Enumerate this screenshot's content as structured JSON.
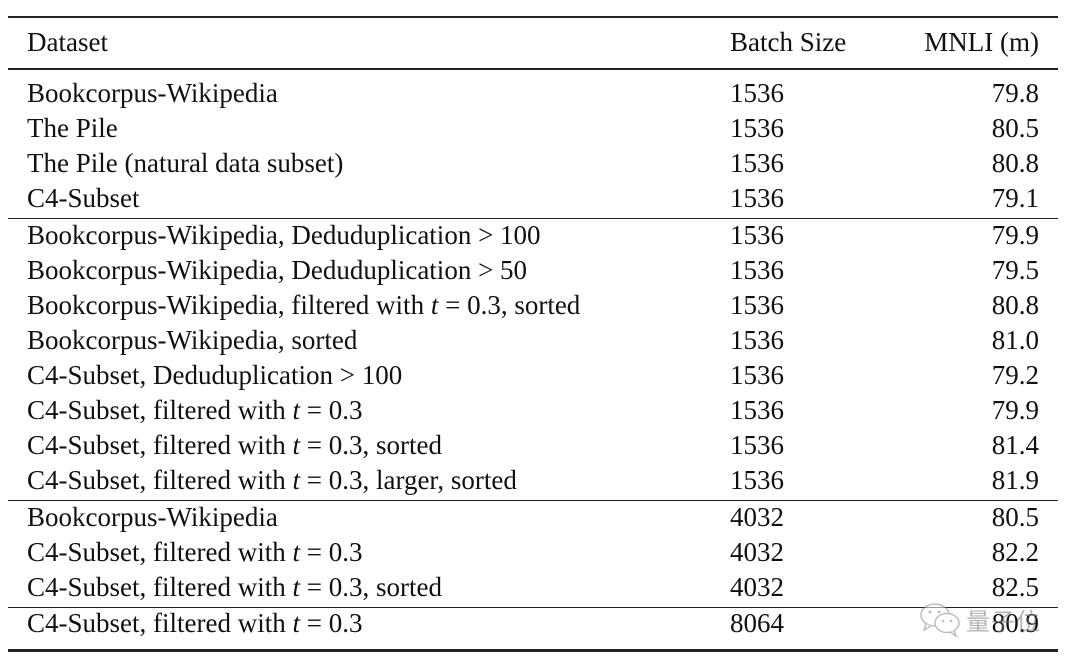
{
  "table": {
    "headers": {
      "dataset": "Dataset",
      "batch_size": "Batch Size",
      "mnli": "MNLI (m)"
    },
    "groups": [
      {
        "rows": [
          {
            "dataset": "Bookcorpus-Wikipedia",
            "batch_size": "1536",
            "mnli": "79.8"
          },
          {
            "dataset": "The Pile",
            "batch_size": "1536",
            "mnli": "80.5"
          },
          {
            "dataset": "The Pile (natural data subset)",
            "batch_size": "1536",
            "mnli": "80.8"
          },
          {
            "dataset": "C4-Subset",
            "batch_size": "1536",
            "mnli": "79.1"
          }
        ]
      },
      {
        "rows": [
          {
            "dataset": "Bookcorpus-Wikipedia, Deduduplication > 100",
            "batch_size": "1536",
            "mnli": "79.9"
          },
          {
            "dataset": "Bookcorpus-Wikipedia, Deduduplication > 50",
            "batch_size": "1536",
            "mnli": "79.5"
          },
          {
            "dataset": "Bookcorpus-Wikipedia, filtered with t = 0.3, sorted",
            "batch_size": "1536",
            "mnli": "80.8"
          },
          {
            "dataset": "Bookcorpus-Wikipedia, sorted",
            "batch_size": "1536",
            "mnli": "81.0"
          },
          {
            "dataset": "C4-Subset, Deduduplication > 100",
            "batch_size": "1536",
            "mnli": "79.2"
          },
          {
            "dataset": "C4-Subset, filtered with t = 0.3",
            "batch_size": "1536",
            "mnli": "79.9"
          },
          {
            "dataset": "C4-Subset, filtered with t = 0.3, sorted",
            "batch_size": "1536",
            "mnli": "81.4"
          },
          {
            "dataset": "C4-Subset, filtered with t = 0.3, larger, sorted",
            "batch_size": "1536",
            "mnli": "81.9"
          }
        ]
      },
      {
        "rows": [
          {
            "dataset": "Bookcorpus-Wikipedia",
            "batch_size": "4032",
            "mnli": "80.5"
          },
          {
            "dataset": "C4-Subset, filtered with t = 0.3",
            "batch_size": "4032",
            "mnli": "82.2"
          },
          {
            "dataset": "C4-Subset, filtered with t = 0.3, sorted",
            "batch_size": "4032",
            "mnli": "82.5"
          }
        ]
      },
      {
        "rows": [
          {
            "dataset": "C4-Subset, filtered with t = 0.3",
            "batch_size": "8064",
            "mnli": "80.9"
          }
        ]
      }
    ]
  },
  "watermark": {
    "icon": "wechat-icon",
    "text": "量子位"
  }
}
